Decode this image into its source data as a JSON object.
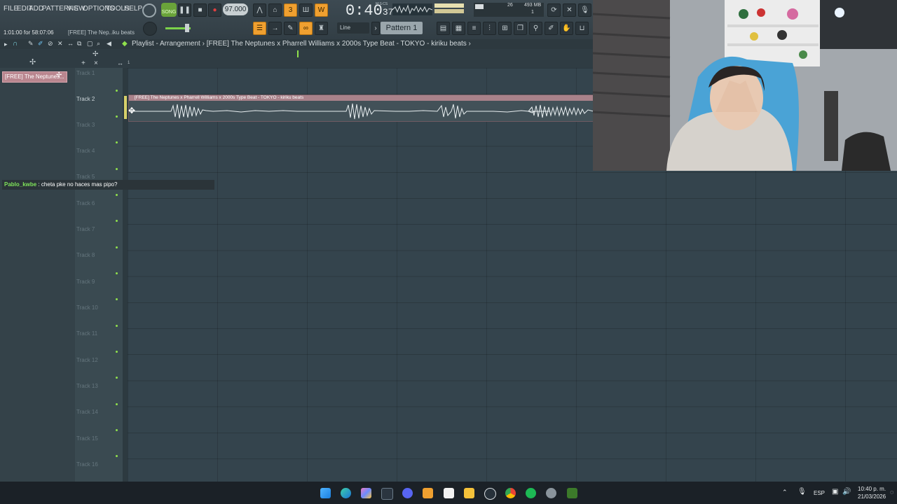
{
  "menu": [
    "FILE",
    "EDIT",
    "ADD",
    "PATTERNS",
    "VIEW",
    "OPTIONS",
    "TOOLS",
    "HELP"
  ],
  "transport": {
    "mode_label": "SONG",
    "tempo": "97.000",
    "clock_main": "0:40",
    "clock_sub": "37",
    "clock_unit": "M:S:CS",
    "hint": "1:01:00 for 58:07:06",
    "hint_file": "[FREE] The Nep..iku beats"
  },
  "monitor": {
    "cpu": "26",
    "memory": "493 MB",
    "polyphony": "1"
  },
  "snap": {
    "value": "Line"
  },
  "pattern": {
    "value": "Pattern 1"
  },
  "playlist": {
    "breadcrumb": "Playlist - Arrangement  ›  [FREE] The Neptunes x Pharrell Williams x 2000s Type Beat - TOKYO - kiriku beats  ›"
  },
  "channel": {
    "label": "[FREE] The Neptunes..."
  },
  "chat": {
    "user": "Pablo_kwbe",
    "message": " : cheta pke no haces mas pipo?"
  },
  "timeline": {
    "start": "1"
  },
  "tracks": [
    "Track 1",
    "Track 2",
    "Track 3",
    "Track 4",
    "Track 5",
    "Track 6",
    "Track 7",
    "Track 8",
    "Track 9",
    "Track 10",
    "Track 11",
    "Track 12",
    "Track 13",
    "Track 14",
    "Track 15",
    "Track 16"
  ],
  "clip": {
    "title": "[FREE] The Neptunes x Pharrell Williams x 2000s Type Beat - TOKYO - kiriku beats"
  },
  "taskbar": {
    "language": "ESP",
    "time": "10:40 p. m.",
    "date": "21/03/2026"
  },
  "colors": {
    "accent": "#f0a030",
    "clip": "#a9828a",
    "active_dot": "#8fe04c"
  }
}
